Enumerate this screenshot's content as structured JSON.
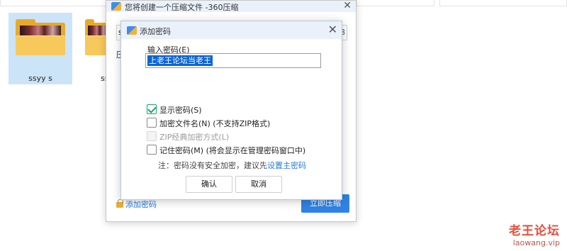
{
  "explorer": {
    "items": [
      {
        "label": "ssyy s"
      },
      {
        "label": "ss"
      }
    ]
  },
  "main_window": {
    "title": "您将创建一个压缩文件  -360压缩",
    "field_start": "s",
    "field_end": "B",
    "side_label": "压",
    "add_password_link": "添加密码",
    "compress_button": "立即压缩"
  },
  "dialog": {
    "title": "添加密码",
    "password_label": "输入密码(E)",
    "password_value": "上老王论坛当老王",
    "options": [
      {
        "label": "显示密码(S)",
        "checked": true,
        "disabled": false
      },
      {
        "label": "加密文件名(N) (不支持ZIP格式)",
        "checked": false,
        "disabled": false
      },
      {
        "label": "ZIP经典加密方式(L)",
        "checked": false,
        "disabled": true
      },
      {
        "label": "记住密码(M) (将会显示在管理密码窗口中)",
        "checked": false,
        "disabled": false
      }
    ],
    "note_text": "注：密码没有安全加密，建议先",
    "note_link": "设置主密码",
    "ok_label": "确认",
    "cancel_label": "取消"
  },
  "watermark": {
    "name": "老王论坛",
    "url": "laowang.vip"
  },
  "colors": {
    "accent": "#2f83e4",
    "check": "#1aa56c",
    "selection": "#0a64d7",
    "watermark": "#e64d3c"
  }
}
